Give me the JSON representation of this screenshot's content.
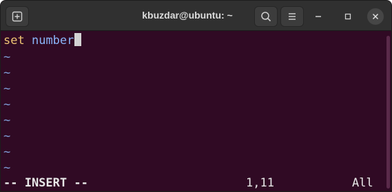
{
  "window": {
    "title": "kbuzdar@ubuntu: ~",
    "buttons": {
      "new_tab_icon": "new-tab-icon",
      "search_icon": "search-icon",
      "menu_icon": "hamburger-menu-icon",
      "minimize": "–",
      "maximize": "□",
      "close": "×"
    }
  },
  "editor": {
    "lines": [
      {
        "set": "set",
        "rest": "number"
      }
    ],
    "tilde": "~",
    "tilde_count": 8,
    "status": {
      "mode": "-- INSERT --",
      "position": "1,11",
      "percent": "All"
    }
  },
  "colors": {
    "background": "#300a24",
    "titlebar": "#303030",
    "keyword_set": "#f0c674",
    "keyword_number": "#8ab4f8",
    "tilde": "#7f9dd6"
  }
}
